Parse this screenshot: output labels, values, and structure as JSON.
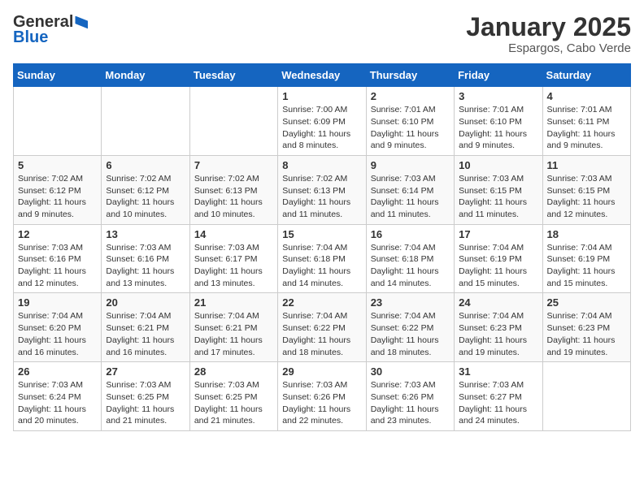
{
  "header": {
    "logo_general": "General",
    "logo_blue": "Blue",
    "month_title": "January 2025",
    "subtitle": "Espargos, Cabo Verde"
  },
  "weekdays": [
    "Sunday",
    "Monday",
    "Tuesday",
    "Wednesday",
    "Thursday",
    "Friday",
    "Saturday"
  ],
  "weeks": [
    [
      {
        "day": "",
        "info": ""
      },
      {
        "day": "",
        "info": ""
      },
      {
        "day": "",
        "info": ""
      },
      {
        "day": "1",
        "info": "Sunrise: 7:00 AM\nSunset: 6:09 PM\nDaylight: 11 hours\nand 8 minutes."
      },
      {
        "day": "2",
        "info": "Sunrise: 7:01 AM\nSunset: 6:10 PM\nDaylight: 11 hours\nand 9 minutes."
      },
      {
        "day": "3",
        "info": "Sunrise: 7:01 AM\nSunset: 6:10 PM\nDaylight: 11 hours\nand 9 minutes."
      },
      {
        "day": "4",
        "info": "Sunrise: 7:01 AM\nSunset: 6:11 PM\nDaylight: 11 hours\nand 9 minutes."
      }
    ],
    [
      {
        "day": "5",
        "info": "Sunrise: 7:02 AM\nSunset: 6:12 PM\nDaylight: 11 hours\nand 9 minutes."
      },
      {
        "day": "6",
        "info": "Sunrise: 7:02 AM\nSunset: 6:12 PM\nDaylight: 11 hours\nand 10 minutes."
      },
      {
        "day": "7",
        "info": "Sunrise: 7:02 AM\nSunset: 6:13 PM\nDaylight: 11 hours\nand 10 minutes."
      },
      {
        "day": "8",
        "info": "Sunrise: 7:02 AM\nSunset: 6:13 PM\nDaylight: 11 hours\nand 11 minutes."
      },
      {
        "day": "9",
        "info": "Sunrise: 7:03 AM\nSunset: 6:14 PM\nDaylight: 11 hours\nand 11 minutes."
      },
      {
        "day": "10",
        "info": "Sunrise: 7:03 AM\nSunset: 6:15 PM\nDaylight: 11 hours\nand 11 minutes."
      },
      {
        "day": "11",
        "info": "Sunrise: 7:03 AM\nSunset: 6:15 PM\nDaylight: 11 hours\nand 12 minutes."
      }
    ],
    [
      {
        "day": "12",
        "info": "Sunrise: 7:03 AM\nSunset: 6:16 PM\nDaylight: 11 hours\nand 12 minutes."
      },
      {
        "day": "13",
        "info": "Sunrise: 7:03 AM\nSunset: 6:16 PM\nDaylight: 11 hours\nand 13 minutes."
      },
      {
        "day": "14",
        "info": "Sunrise: 7:03 AM\nSunset: 6:17 PM\nDaylight: 11 hours\nand 13 minutes."
      },
      {
        "day": "15",
        "info": "Sunrise: 7:04 AM\nSunset: 6:18 PM\nDaylight: 11 hours\nand 14 minutes."
      },
      {
        "day": "16",
        "info": "Sunrise: 7:04 AM\nSunset: 6:18 PM\nDaylight: 11 hours\nand 14 minutes."
      },
      {
        "day": "17",
        "info": "Sunrise: 7:04 AM\nSunset: 6:19 PM\nDaylight: 11 hours\nand 15 minutes."
      },
      {
        "day": "18",
        "info": "Sunrise: 7:04 AM\nSunset: 6:19 PM\nDaylight: 11 hours\nand 15 minutes."
      }
    ],
    [
      {
        "day": "19",
        "info": "Sunrise: 7:04 AM\nSunset: 6:20 PM\nDaylight: 11 hours\nand 16 minutes."
      },
      {
        "day": "20",
        "info": "Sunrise: 7:04 AM\nSunset: 6:21 PM\nDaylight: 11 hours\nand 16 minutes."
      },
      {
        "day": "21",
        "info": "Sunrise: 7:04 AM\nSunset: 6:21 PM\nDaylight: 11 hours\nand 17 minutes."
      },
      {
        "day": "22",
        "info": "Sunrise: 7:04 AM\nSunset: 6:22 PM\nDaylight: 11 hours\nand 18 minutes."
      },
      {
        "day": "23",
        "info": "Sunrise: 7:04 AM\nSunset: 6:22 PM\nDaylight: 11 hours\nand 18 minutes."
      },
      {
        "day": "24",
        "info": "Sunrise: 7:04 AM\nSunset: 6:23 PM\nDaylight: 11 hours\nand 19 minutes."
      },
      {
        "day": "25",
        "info": "Sunrise: 7:04 AM\nSunset: 6:23 PM\nDaylight: 11 hours\nand 19 minutes."
      }
    ],
    [
      {
        "day": "26",
        "info": "Sunrise: 7:03 AM\nSunset: 6:24 PM\nDaylight: 11 hours\nand 20 minutes."
      },
      {
        "day": "27",
        "info": "Sunrise: 7:03 AM\nSunset: 6:25 PM\nDaylight: 11 hours\nand 21 minutes."
      },
      {
        "day": "28",
        "info": "Sunrise: 7:03 AM\nSunset: 6:25 PM\nDaylight: 11 hours\nand 21 minutes."
      },
      {
        "day": "29",
        "info": "Sunrise: 7:03 AM\nSunset: 6:26 PM\nDaylight: 11 hours\nand 22 minutes."
      },
      {
        "day": "30",
        "info": "Sunrise: 7:03 AM\nSunset: 6:26 PM\nDaylight: 11 hours\nand 23 minutes."
      },
      {
        "day": "31",
        "info": "Sunrise: 7:03 AM\nSunset: 6:27 PM\nDaylight: 11 hours\nand 24 minutes."
      },
      {
        "day": "",
        "info": ""
      }
    ]
  ]
}
